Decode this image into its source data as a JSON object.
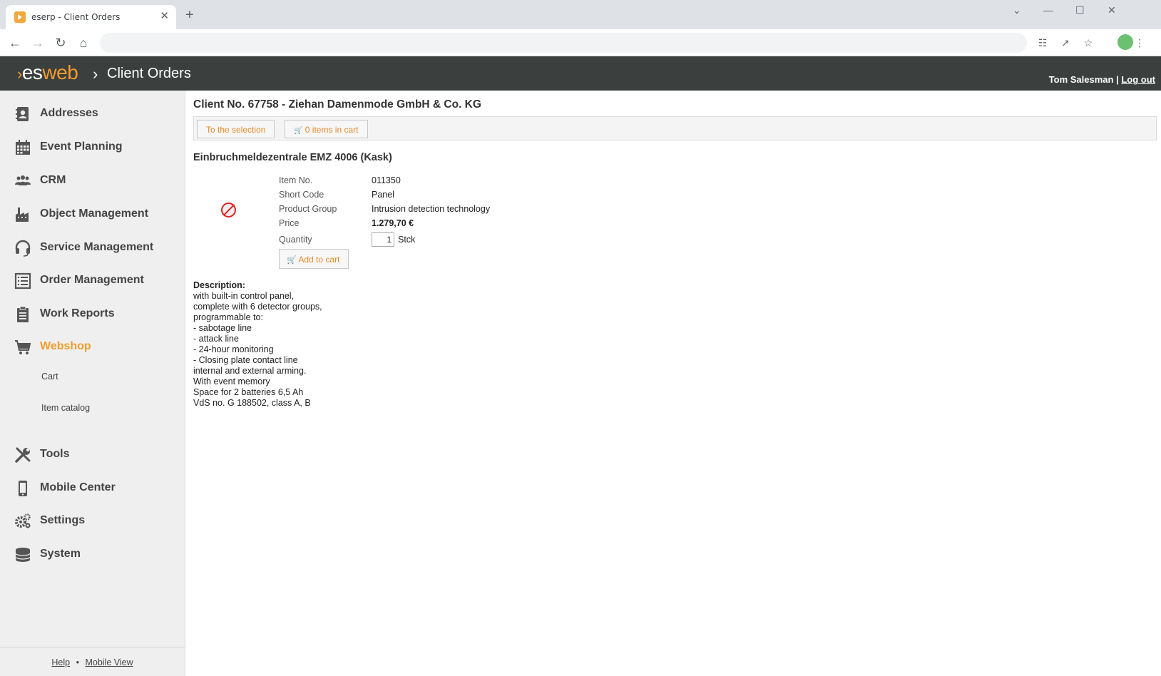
{
  "browser": {
    "tab_title": "eserp - Client Orders",
    "tab_close": "✕",
    "new_tab": "+"
  },
  "header": {
    "logo_es": "es",
    "logo_web": "web",
    "page_title": "Client Orders",
    "user_name": "Tom Salesman",
    "separator": "|",
    "logout": "Log out"
  },
  "sidebar": {
    "items": [
      {
        "label": "Addresses",
        "icon": "address-book-icon"
      },
      {
        "label": "Event Planning",
        "icon": "calendar-icon"
      },
      {
        "label": "CRM",
        "icon": "people-icon"
      },
      {
        "label": "Object Management",
        "icon": "factory-icon"
      },
      {
        "label": "Service Management",
        "icon": "headset-icon"
      },
      {
        "label": "Order Management",
        "icon": "list-icon"
      },
      {
        "label": "Work Reports",
        "icon": "clipboard-icon"
      },
      {
        "label": "Webshop",
        "icon": "cart-icon",
        "active": true
      },
      {
        "label": "Tools",
        "icon": "tools-icon"
      },
      {
        "label": "Mobile Center",
        "icon": "phone-icon"
      },
      {
        "label": "Settings",
        "icon": "gears-icon"
      },
      {
        "label": "System",
        "icon": "server-icon"
      }
    ],
    "sub_items": [
      "Cart",
      "Item catalog"
    ],
    "footer": {
      "help": "Help",
      "dot": "•",
      "mobile_view": "Mobile View"
    }
  },
  "main": {
    "client_title": "Client No. 67758 - Ziehan Damenmode GmbH & Co. KG",
    "to_selection": "To the selection",
    "cart_button": "0 items in cart",
    "product_title": "Einbruchmeldezentrale EMZ 4006 (Kask)",
    "props": {
      "item_no_label": "Item No.",
      "item_no": "011350",
      "short_code_label": "Short Code",
      "short_code": "Panel",
      "group_label": "Product Group",
      "group": "Intrusion detection technology",
      "price_label": "Price",
      "price": "1.279,70 €",
      "quantity_label": "Quantity",
      "quantity": "1",
      "unit": "Stck"
    },
    "add_to_cart": "Add to cart",
    "description_label": "Description:",
    "description_lines": [
      "with built-in control panel,",
      "complete with 6 detector groups,",
      "programmable to:",
      "- sabotage line",
      "- attack line",
      "- 24-hour monitoring",
      "- Closing plate contact line",
      "internal and external arming.",
      "With event memory",
      "Space for 2 batteries 6,5 Ah",
      "VdS no. G 188502, class A, B"
    ]
  },
  "colors": {
    "accent": "#f39c2c",
    "header_bg": "#3b3f3e",
    "sidebar_bg": "#efefef"
  }
}
